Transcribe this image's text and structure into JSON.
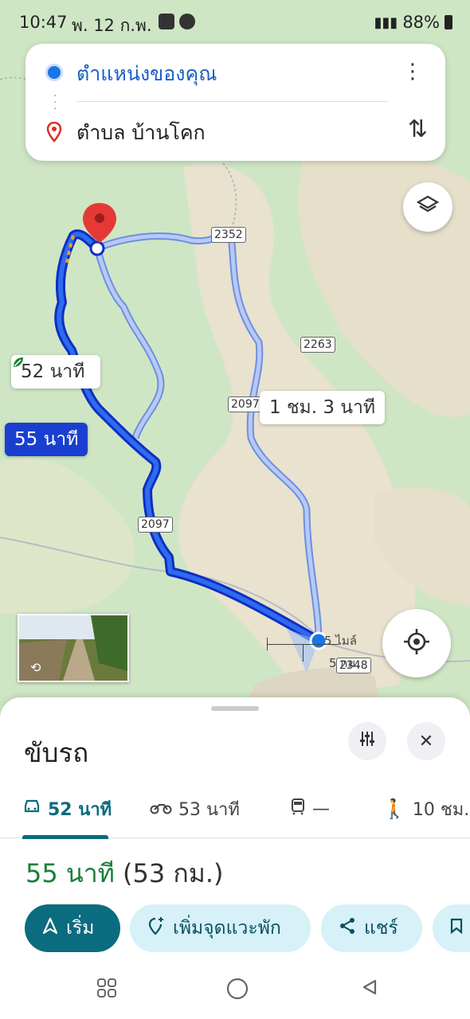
{
  "status_bar": {
    "time": "10:47",
    "date": "พ. 12 ก.พ.",
    "battery": "88%"
  },
  "search": {
    "origin": "ตำแหน่งของคุณ",
    "destination": "ตำบล บ้านโคก"
  },
  "map": {
    "route_badges": {
      "eco": "52 นาที",
      "selected": "55 นาที",
      "alt": "1 ชม. 3 นาที"
    },
    "road_labels": [
      "2352",
      "2263",
      "2097",
      "2097",
      "2348"
    ],
    "scale": {
      "miles": "5 ไมล์",
      "km": "5 กม."
    }
  },
  "sheet": {
    "title": "ขับรถ",
    "tabs": [
      {
        "label": "52 นาที",
        "icon": "car-icon"
      },
      {
        "label": "53 นาที",
        "icon": "motorcycle-icon"
      },
      {
        "label": "—",
        "icon": "train-icon"
      },
      {
        "label": "10 ชม.",
        "icon": "walk-icon"
      }
    ],
    "summary_time": "55 นาที",
    "summary_distance": "(53 กม.)",
    "actions": {
      "start": "เริ่ม",
      "add_stop": "เพิ่มจุดแวะพัก",
      "share": "แชร์"
    }
  },
  "colors": {
    "route_selected": "#1a3fd0",
    "route_alt": "#9fb7f5",
    "accent": "#0b6b7f",
    "eco_green": "#188038"
  }
}
